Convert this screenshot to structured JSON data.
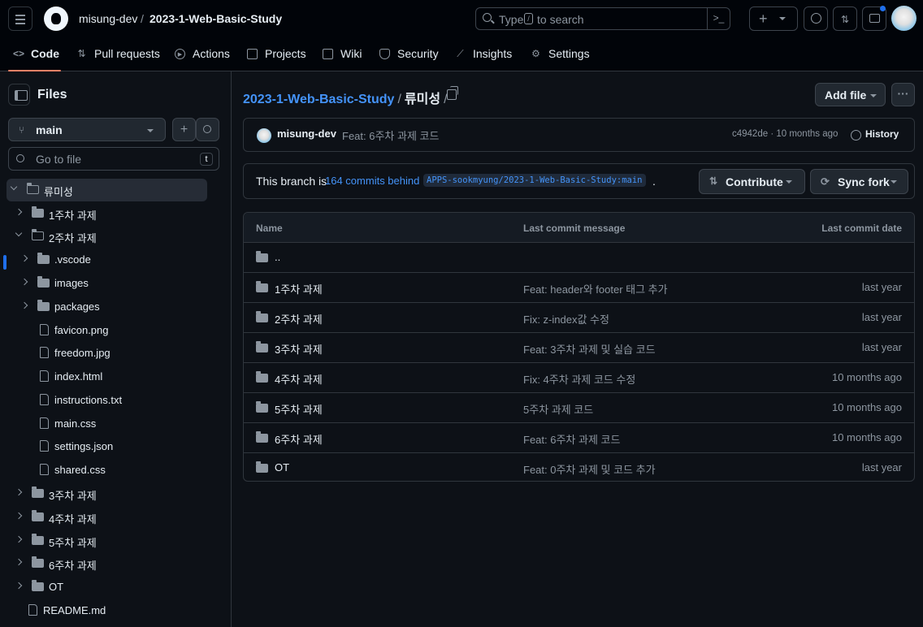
{
  "header": {
    "owner": "misung-dev",
    "separator": "/",
    "repo": "2023-1-Web-Basic-Study",
    "search": {
      "prefix": "Type",
      "key": "/",
      "suffix": "to search"
    }
  },
  "tabs": [
    {
      "label": "Code",
      "icon": "code-icon"
    },
    {
      "label": "Pull requests",
      "icon": "pull-request-icon"
    },
    {
      "label": "Actions",
      "icon": "play-icon"
    },
    {
      "label": "Projects",
      "icon": "table-icon"
    },
    {
      "label": "Wiki",
      "icon": "book-icon"
    },
    {
      "label": "Security",
      "icon": "shield-icon"
    },
    {
      "label": "Insights",
      "icon": "graph-icon"
    },
    {
      "label": "Settings",
      "icon": "gear-icon"
    }
  ],
  "sidebar": {
    "title": "Files",
    "branch": "main",
    "goto_placeholder": "Go to file",
    "goto_key": "t",
    "tree": [
      "류미성",
      "1주차 과제",
      "2주차 과제",
      ".vscode",
      "images",
      "packages",
      "favicon.png",
      "freedom.jpg",
      "index.html",
      "instructions.txt",
      "main.css",
      "settings.json",
      "shared.css",
      "3주차 과제",
      "4주차 과제",
      "5주차 과제",
      "6주차 과제",
      "OT",
      "README.md"
    ]
  },
  "main": {
    "path_repo": "2023-1-Web-Basic-Study",
    "path_sep": "/",
    "path_folder": "류미성",
    "path_trail": "/",
    "add_file": "Add file",
    "more": "···",
    "commit": {
      "author": "misung-dev",
      "message": "Feat: 6주차 과제 코드",
      "sha_time": "c4942de · 10 months ago",
      "history": "History"
    },
    "branch_status": {
      "prefix": "This branch is",
      "link": "164 commits behind",
      "ref": "APPS-sookmyung/2023-1-Web-Basic-Study:main",
      "suffix": ".",
      "contribute": "Contribute",
      "sync": "Sync fork"
    },
    "table": {
      "headers": [
        "Name",
        "Last commit message",
        "Last commit date"
      ],
      "parent": "..",
      "rows": [
        {
          "name": "1주차 과제",
          "message": "Feat: header와 footer 태그 추가",
          "date": "last year"
        },
        {
          "name": "2주차 과제",
          "message": "Fix: z-index값 수정",
          "date": "last year"
        },
        {
          "name": "3주차 과제",
          "message": "Feat: 3주차 과제 및 실습 코드",
          "date": "last year"
        },
        {
          "name": "4주차 과제",
          "message": "Fix: 4주차 과제 코드 수정",
          "date": "10 months ago"
        },
        {
          "name": "5주차 과제",
          "message": "5주차 과제 코드",
          "date": "10 months ago"
        },
        {
          "name": "6주차 과제",
          "message": "Feat: 6주차 과제 코드",
          "date": "10 months ago"
        },
        {
          "name": "OT",
          "message": "Feat: 0주차 과제 및 코드 추가",
          "date": "last year"
        }
      ]
    }
  }
}
